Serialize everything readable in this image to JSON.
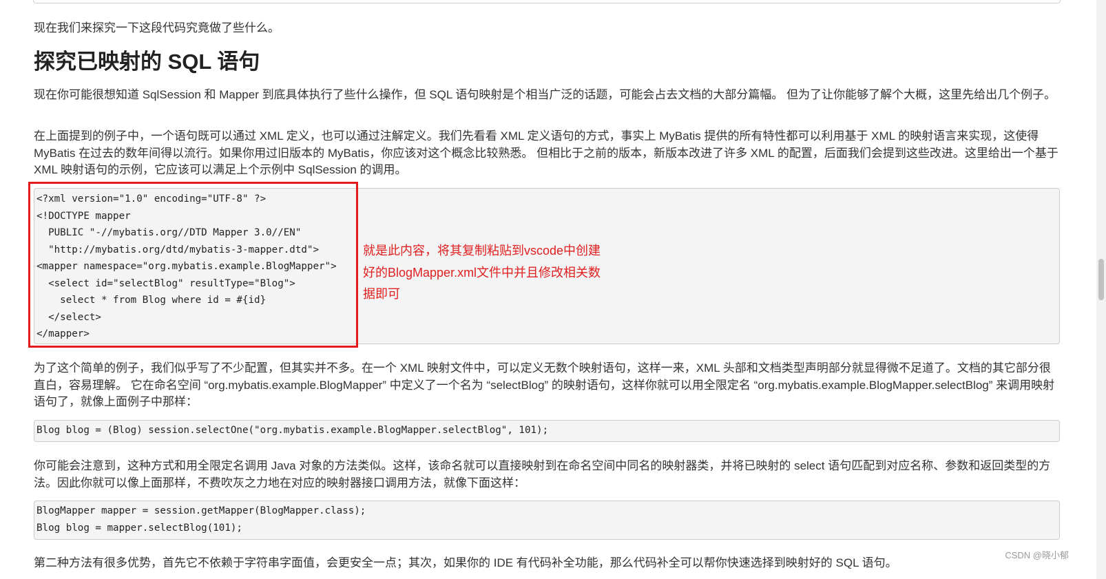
{
  "intro": "现在我们来探究一下这段代码究竟做了些什么。",
  "heading": "探究已映射的 SQL 语句",
  "p1": "现在你可能很想知道 SqlSession 和 Mapper 到底具体执行了些什么操作，但 SQL 语句映射是个相当广泛的话题，可能会占去文档的大部分篇幅。 但为了让你能够了解个大概，这里先给出几个例子。",
  "p2": "在上面提到的例子中，一个语句既可以通过 XML 定义，也可以通过注解定义。我们先看看 XML 定义语句的方式，事实上 MyBatis 提供的所有特性都可以利用基于 XML 的映射语言来实现，这使得 MyBatis 在过去的数年间得以流行。如果你用过旧版本的 MyBatis，你应该对这个概念比较熟悉。 但相比于之前的版本，新版本改进了许多 XML 的配置，后面我们会提到这些改进。这里给出一个基于 XML 映射语句的示例，它应该可以满足上个示例中 SqlSession 的调用。",
  "code1": [
    "<?xml version=\"1.0\" encoding=\"UTF-8\" ?>",
    "<!DOCTYPE mapper",
    "  PUBLIC \"-//mybatis.org//DTD Mapper 3.0//EN\"",
    "  \"http://mybatis.org/dtd/mybatis-3-mapper.dtd\">",
    "<mapper namespace=\"org.mybatis.example.BlogMapper\">",
    "  <select id=\"selectBlog\" resultType=\"Blog\">",
    "    select * from Blog where id = #{id}",
    "  </select>",
    "</mapper>"
  ],
  "annotation": "就是此内容，将其复制粘贴到vscode中创建好的BlogMapper.xml文件中并且修改相关数据即可",
  "p3": "为了这个简单的例子，我们似乎写了不少配置，但其实并不多。在一个 XML 映射文件中，可以定义无数个映射语句，这样一来，XML 头部和文档类型声明部分就显得微不足道了。文档的其它部分很直白，容易理解。 它在命名空间 “org.mybatis.example.BlogMapper” 中定义了一个名为 “selectBlog” 的映射语句，这样你就可以用全限定名 “org.mybatis.example.BlogMapper.selectBlog” 来调用映射语句了，就像上面例子中那样：",
  "code2": [
    "Blog blog = (Blog) session.selectOne(\"org.mybatis.example.BlogMapper.selectBlog\", 101);"
  ],
  "p4": "你可能会注意到，这种方式和用全限定名调用 Java 对象的方法类似。这样，该命名就可以直接映射到在命名空间中同名的映射器类，并将已映射的 select 语句匹配到对应名称、参数和返回类型的方法。因此你就可以像上面那样，不费吹灰之力地在对应的映射器接口调用方法，就像下面这样：",
  "code3": [
    "BlogMapper mapper = session.getMapper(BlogMapper.class);",
    "Blog blog = mapper.selectBlog(101);"
  ],
  "p5": "第二种方法有很多优势，首先它不依赖于字符串字面值，会更安全一点；其次，如果你的 IDE 有代码补全功能，那么代码补全可以帮你快速选择到映射好的 SQL 语句。",
  "watermark": "CSDN @晓小郁"
}
